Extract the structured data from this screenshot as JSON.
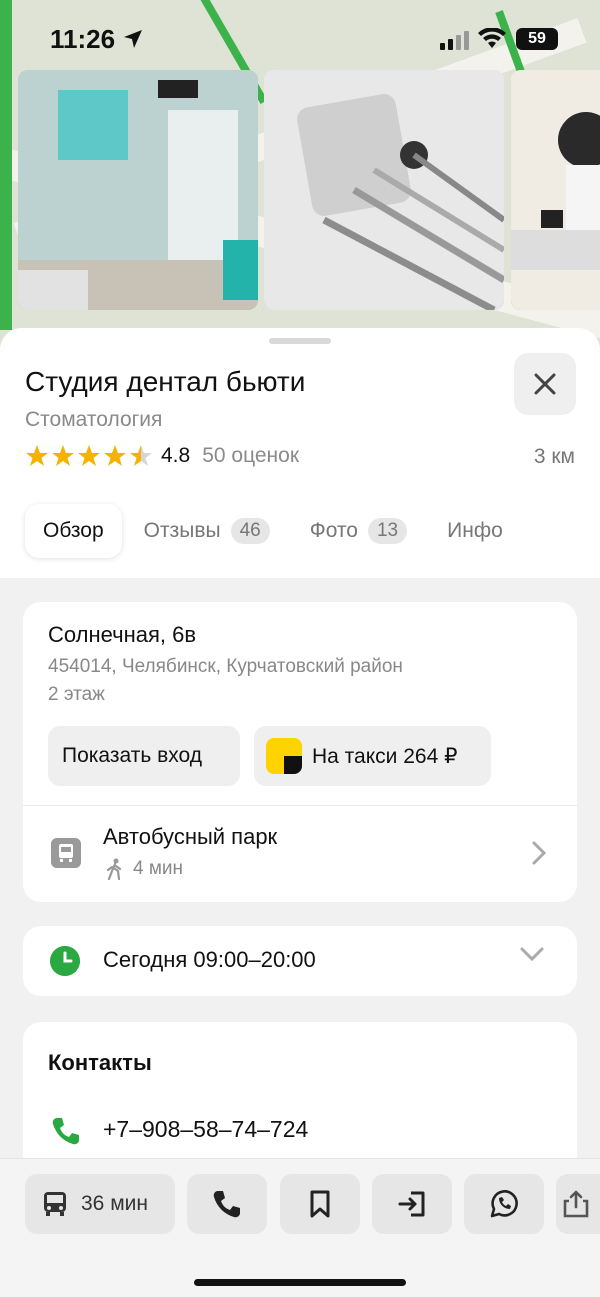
{
  "status_bar": {
    "time": "11:26",
    "battery": "59"
  },
  "place": {
    "title": "Студия дентал бьюти",
    "category": "Стоматология",
    "rating": "4.8",
    "rating_stars": 4.5,
    "rating_count": "50 оценок",
    "distance": "3 км"
  },
  "tabs": [
    {
      "label": "Обзор",
      "active": true,
      "badge": ""
    },
    {
      "label": "Отзывы",
      "active": false,
      "badge": "46"
    },
    {
      "label": "Фото",
      "active": false,
      "badge": "13"
    },
    {
      "label": "Инфо",
      "active": false,
      "badge": ""
    }
  ],
  "address": {
    "street": "Солнечная, 6в",
    "details": "454014, Челябинск, Курчатовский район",
    "floor": "2 этаж",
    "show_entrance": "Показать вход",
    "taxi": "На такси 264 ₽"
  },
  "transit": {
    "stop_name": "Автобусный парк",
    "walk_time": "4 мин"
  },
  "hours": {
    "text": "Сегодня 09:00–20:00"
  },
  "contacts": {
    "title": "Контакты",
    "phone": "+7‒908‒58‒74‒724"
  },
  "actions": {
    "route_time": "36 мин"
  },
  "colors": {
    "accent_green": "#2aa842",
    "star": "#f2b400",
    "taxi_yellow": "#ffd300"
  }
}
